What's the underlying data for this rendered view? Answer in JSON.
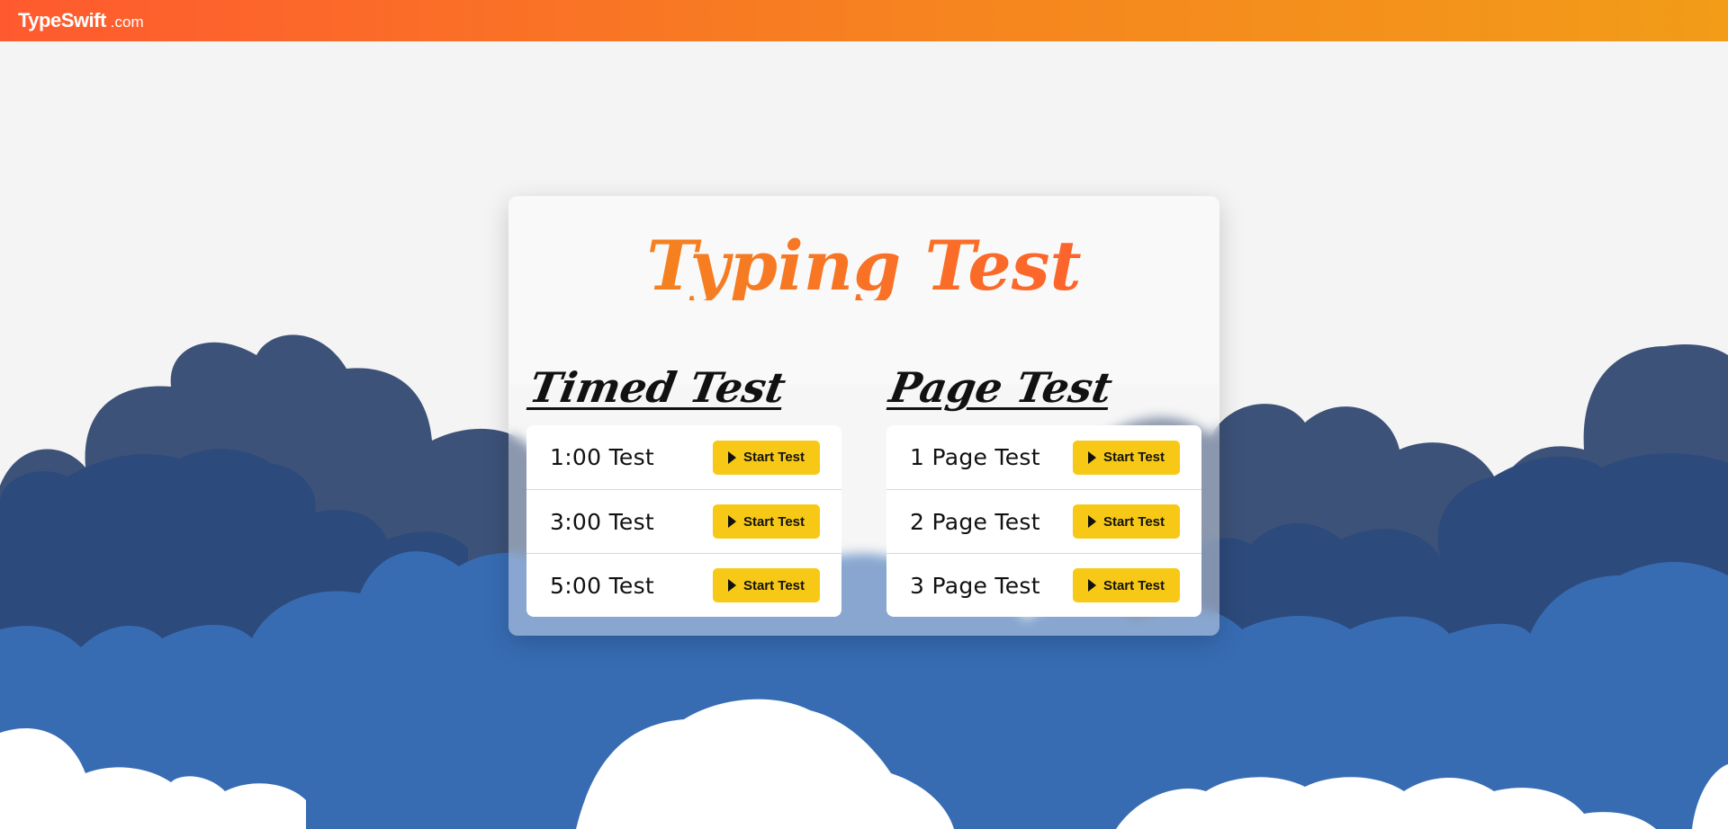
{
  "header": {
    "brand_name": "TypeSwift",
    "brand_tld": ".com"
  },
  "card": {
    "title": "Typing Test",
    "sections": [
      {
        "heading": "Timed Test",
        "tests": [
          {
            "label": "1:00 Test",
            "button": "Start Test"
          },
          {
            "label": "3:00 Test",
            "button": "Start Test"
          },
          {
            "label": "5:00 Test",
            "button": "Start Test"
          }
        ]
      },
      {
        "heading": "Page Test",
        "tests": [
          {
            "label": "1 Page Test",
            "button": "Start Test"
          },
          {
            "label": "2 Page Test",
            "button": "Start Test"
          },
          {
            "label": "3 Page Test",
            "button": "Start Test"
          }
        ]
      }
    ]
  },
  "colors": {
    "header_start": "#ff5a2f",
    "header_end": "#f29c18",
    "title_gradient_start": "#f28b1c",
    "title_gradient_end": "#ff5a2f",
    "button_bg": "#f7c916",
    "cloud_back": "#3d5278",
    "cloud_mid": "#2d4a7c",
    "cloud_front": "#376cb3",
    "cloud_light": "#ffffff"
  },
  "icons": {
    "start_button_icon": "play-icon"
  }
}
